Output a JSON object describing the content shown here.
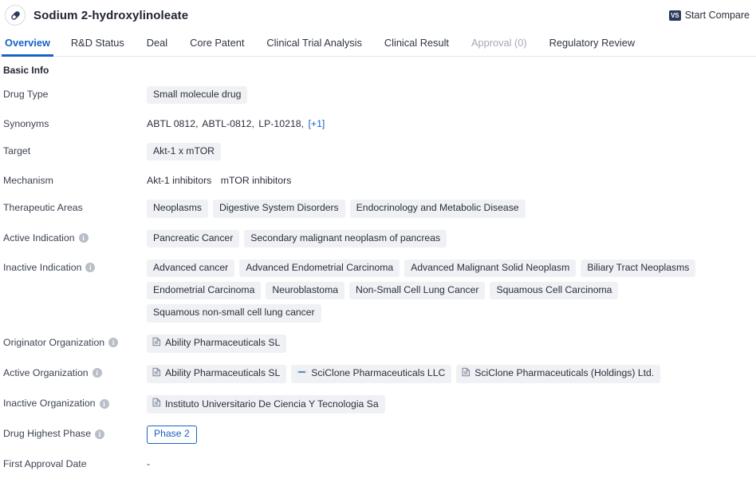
{
  "header": {
    "logo_icon": "pill-capsule-icon",
    "title": "Sodium 2-hydroxylinoleate",
    "compare": {
      "badge": "VS",
      "label": "Start Compare"
    }
  },
  "tabs": [
    {
      "label": "Overview",
      "state": "active"
    },
    {
      "label": "R&D Status",
      "state": "normal"
    },
    {
      "label": "Deal",
      "state": "normal"
    },
    {
      "label": "Core Patent",
      "state": "normal"
    },
    {
      "label": "Clinical Trial Analysis",
      "state": "normal"
    },
    {
      "label": "Clinical Result",
      "state": "normal"
    },
    {
      "label": "Approval (0)",
      "state": "disabled"
    },
    {
      "label": "Regulatory Review",
      "state": "normal"
    }
  ],
  "section": {
    "title": "Basic Info"
  },
  "rows": {
    "drug_type": {
      "label": "Drug Type",
      "chips": [
        "Small molecule drug"
      ]
    },
    "synonyms": {
      "label": "Synonyms",
      "items": [
        "ABTL 0812,",
        "ABTL-0812,",
        "LP-10218,"
      ],
      "more_link": "[+1]"
    },
    "target": {
      "label": "Target",
      "chips": [
        "Akt-1 x mTOR"
      ]
    },
    "mechanism": {
      "label": "Mechanism",
      "items": [
        "Akt-1 inhibitors",
        "mTOR inhibitors"
      ]
    },
    "therapeutic_areas": {
      "label": "Therapeutic Areas",
      "chips": [
        "Neoplasms",
        "Digestive System Disorders",
        "Endocrinology and Metabolic Disease"
      ]
    },
    "active_indication": {
      "label": "Active Indication",
      "info": "i",
      "chips": [
        "Pancreatic Cancer",
        "Secondary malignant neoplasm of pancreas"
      ]
    },
    "inactive_indication": {
      "label": "Inactive Indication",
      "info": "i",
      "chips": [
        "Advanced cancer",
        "Advanced Endometrial Carcinoma",
        "Advanced Malignant Solid Neoplasm",
        "Biliary Tract Neoplasms",
        "Endometrial Carcinoma",
        "Neuroblastoma",
        "Non-Small Cell Lung Cancer",
        "Squamous Cell Carcinoma",
        "Squamous non-small cell lung cancer"
      ]
    },
    "originator_organization": {
      "label": "Originator Organization",
      "info": "i",
      "orgs": [
        {
          "name": "Ability Pharmaceuticals SL",
          "icon": "document-logo-icon"
        }
      ]
    },
    "active_organization": {
      "label": "Active Organization",
      "info": "i",
      "orgs": [
        {
          "name": "Ability Pharmaceuticals SL",
          "icon": "document-logo-icon"
        },
        {
          "name": "SciClone Pharmaceuticals LLC",
          "icon": "dash-logo-icon"
        },
        {
          "name": "SciClone Pharmaceuticals (Holdings) Ltd.",
          "icon": "document-logo-icon"
        }
      ]
    },
    "inactive_organization": {
      "label": "Inactive Organization",
      "info": "i",
      "orgs": [
        {
          "name": "Instituto Universitario De Ciencia Y Tecnologia Sa",
          "icon": "document-logo-icon"
        }
      ]
    },
    "drug_highest_phase": {
      "label": "Drug Highest Phase",
      "info": "i",
      "badge": "Phase 2"
    },
    "first_approval_date": {
      "label": "First Approval Date",
      "value": "-"
    }
  },
  "colors": {
    "accent": "#1763c6",
    "chip_bg": "#f0f1f4",
    "text": "#2a2f3a",
    "muted": "#a3a9b4",
    "badge_navy": "#2b3a5c"
  }
}
